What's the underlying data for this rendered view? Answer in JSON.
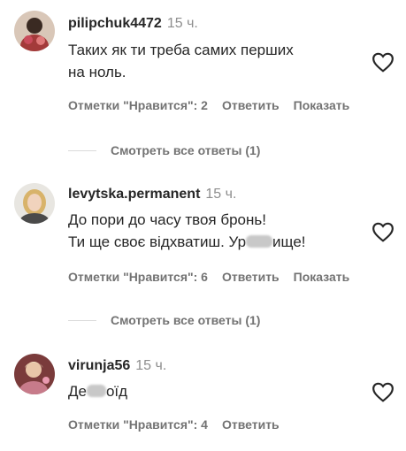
{
  "comments": [
    {
      "username": "pilipchuk4472",
      "time": "15 ч.",
      "text_line1": "Таких як ти треба самих перших",
      "text_line2": "на ноль.",
      "likes": "Отметки \"Нравится\": 2",
      "reply": "Ответить",
      "translate": "Показать",
      "view_replies": "Смотреть все ответы (1)"
    },
    {
      "username": "levytska.permanent",
      "time": "15 ч.",
      "text_line1": "До пори до часу твоя бронь!",
      "text_line2_a": "Ти ще своє відхватиш. Ур",
      "text_line2_b": "ище!",
      "likes": "Отметки \"Нравится\": 6",
      "reply": "Ответить",
      "translate": "Показать",
      "view_replies": "Смотреть все ответы (1)"
    },
    {
      "username": "virunja56",
      "time": "15 ч.",
      "text_a": "Де",
      "text_b": "оїд",
      "likes": "Отметки \"Нравится\": 4",
      "reply": "Ответить"
    }
  ],
  "icons": {
    "like": "heart-outline-icon"
  },
  "colors": {
    "text": "#262626",
    "muted": "#737373",
    "time": "#8e8e8e"
  }
}
